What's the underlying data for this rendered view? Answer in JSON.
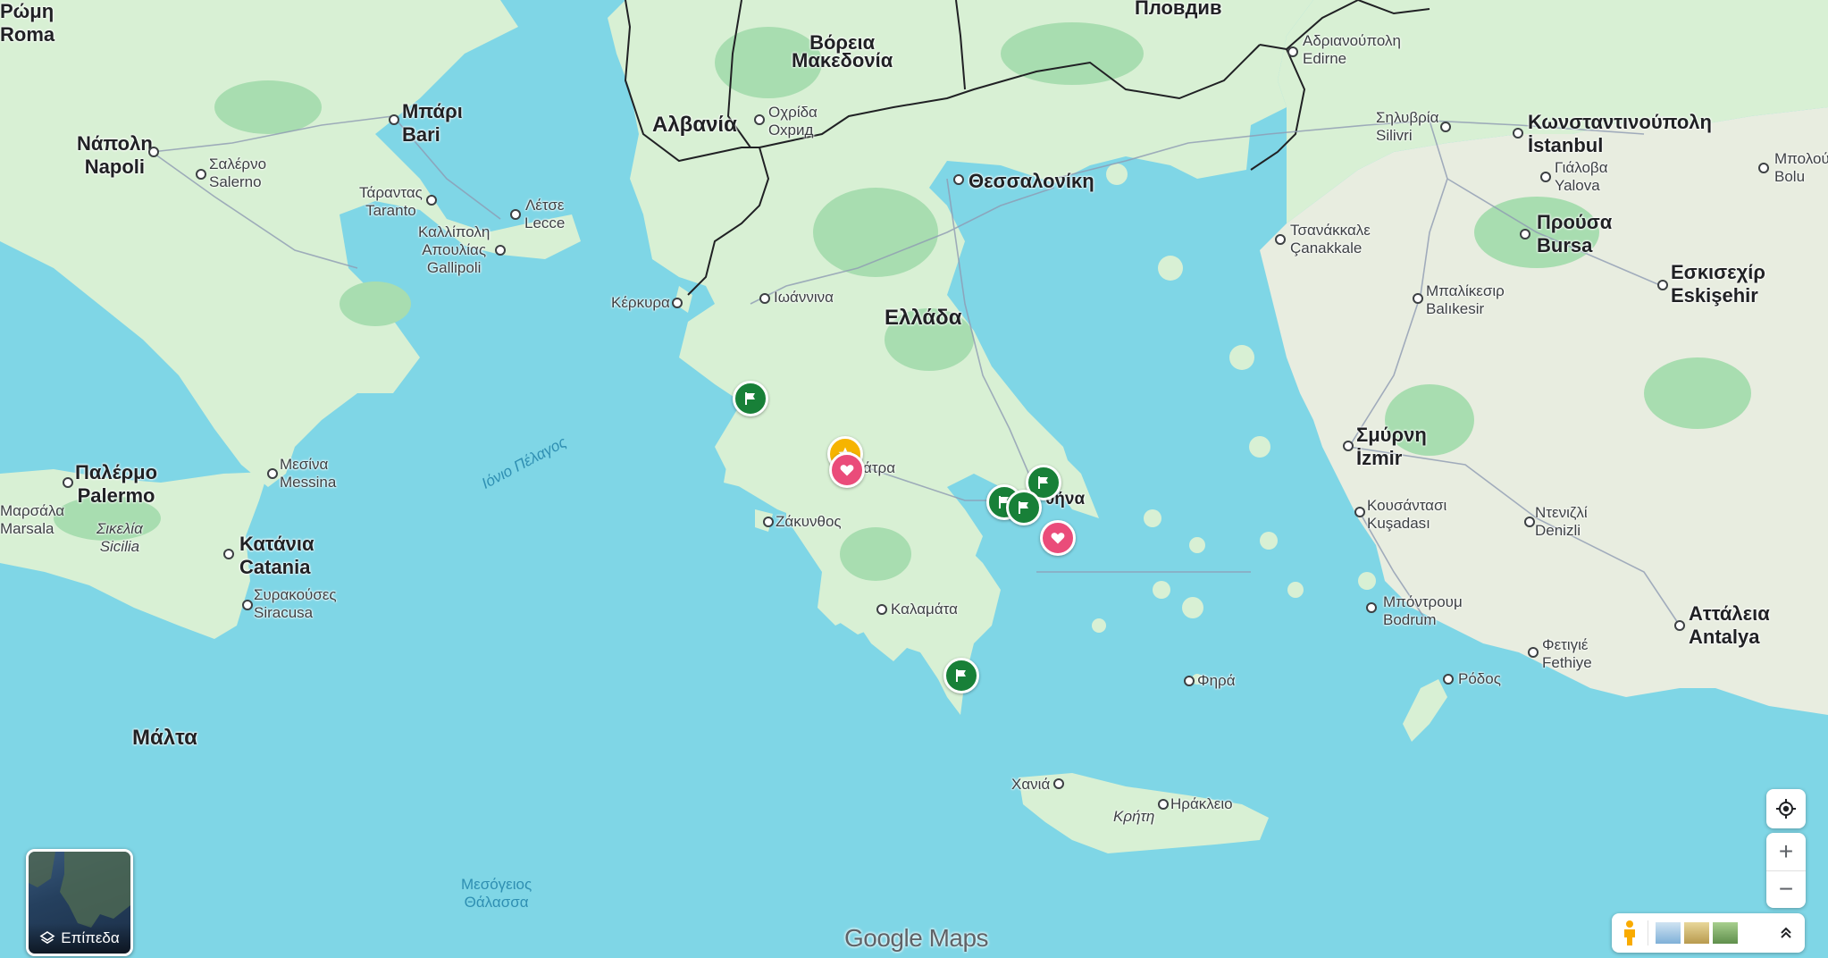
{
  "map": {
    "countries": [
      {
        "id": "albania",
        "name": "Αλβανία"
      },
      {
        "id": "north-macedonia",
        "name": "Βόρεια\nΜακεδονία"
      },
      {
        "id": "greece",
        "name": "Ελλάδα"
      },
      {
        "id": "malta",
        "name": "Μάλτα"
      }
    ],
    "cities": [
      {
        "id": "roma",
        "name": "Ρώμη\nRoma"
      },
      {
        "id": "napoli",
        "name": "Νάπολη\nNapoli"
      },
      {
        "id": "bari",
        "name": "Μπάρι\nBari"
      },
      {
        "id": "salerno",
        "name": "Σαλέρνο\nSalerno"
      },
      {
        "id": "taranto",
        "name": "Τάραντας\nTaranto"
      },
      {
        "id": "lecce",
        "name": "Λέτσε\nLecce"
      },
      {
        "id": "gallipoli",
        "name": "Καλλίπολη\nΑπουλίας\nGallipoli"
      },
      {
        "id": "palermo",
        "name": "Παλέρμο\nPalermo"
      },
      {
        "id": "messina",
        "name": "Μεσίνα\nMessina"
      },
      {
        "id": "marsala",
        "name": "Μαρσάλα\nMarsala"
      },
      {
        "id": "catania",
        "name": "Κατάνια\nCatania"
      },
      {
        "id": "siracusa",
        "name": "Συρακούσες\nSiracusa"
      },
      {
        "id": "ohrid",
        "name": "Οχρίδα\nОхрид"
      },
      {
        "id": "kerkyra",
        "name": "Κέρκυρα"
      },
      {
        "id": "ioannina",
        "name": "Ιωάννινα"
      },
      {
        "id": "thessaloniki",
        "name": "Θεσσαλονίκη"
      },
      {
        "id": "plovdiv",
        "name": "Пловдив"
      },
      {
        "id": "edirne",
        "name": "Αδριανούπολη\nEdirne"
      },
      {
        "id": "istanbul",
        "name": "Κωνσταντινούπολη\nİstanbul"
      },
      {
        "id": "silivri",
        "name": "Σηλυβρία\nSilivri"
      },
      {
        "id": "yalova",
        "name": "Γιάλοβα\nYalova"
      },
      {
        "id": "bolu",
        "name": "Μπολού\nBolu"
      },
      {
        "id": "canakkale",
        "name": "Τσανάκκαλε\nÇanakkale"
      },
      {
        "id": "bursa",
        "name": "Προύσα\nBursa"
      },
      {
        "id": "balikesir",
        "name": "Μπαλίκεσιρ\nBalıkesir"
      },
      {
        "id": "eskisehir",
        "name": "Εσκισεχίρ\nEskişehir"
      },
      {
        "id": "izmir",
        "name": "Σμύρνη\nİzmir"
      },
      {
        "id": "kusadasi",
        "name": "Κουσάντασι\nKuşadası"
      },
      {
        "id": "denizli",
        "name": "Ντενιζλί\nDenizli"
      },
      {
        "id": "bodrum",
        "name": "Μπόντρουμ\nBodrum"
      },
      {
        "id": "fethiye",
        "name": "Φετιγιέ\nFethiye"
      },
      {
        "id": "antalya",
        "name": "Αττάλεια\nAntalya"
      },
      {
        "id": "rodos",
        "name": "Ρόδος"
      },
      {
        "id": "patra",
        "name": "άτρα"
      },
      {
        "id": "athina",
        "name": "θήνα"
      },
      {
        "id": "zakynthos",
        "name": "Ζάκυνθος"
      },
      {
        "id": "kalamata",
        "name": "Καλαμάτα"
      },
      {
        "id": "fira",
        "name": "Φηρά"
      },
      {
        "id": "chania",
        "name": "Χανιά"
      },
      {
        "id": "irakleio",
        "name": "Ηράκλειο"
      }
    ],
    "islands": [
      {
        "id": "sicilia",
        "name": "Σικελία\nSicilia"
      },
      {
        "id": "kriti",
        "name": "Κρήτη"
      }
    ],
    "seas": [
      {
        "id": "ionian",
        "name": "Ιόνιο Πέλαγος"
      },
      {
        "id": "mediterranean",
        "name": "Μεσόγειος\nΘάλασσα"
      }
    ],
    "markers": [
      {
        "id": "flag-1",
        "type": "flag",
        "icon": "flag-icon"
      },
      {
        "id": "star-1",
        "type": "star",
        "icon": "star-icon"
      },
      {
        "id": "heart-1",
        "type": "heart",
        "icon": "heart-icon"
      },
      {
        "id": "flag-2",
        "type": "flag",
        "icon": "flag-icon"
      },
      {
        "id": "flag-3",
        "type": "flag",
        "icon": "flag-icon"
      },
      {
        "id": "flag-4",
        "type": "flag",
        "icon": "flag-icon"
      },
      {
        "id": "heart-2",
        "type": "heart",
        "icon": "heart-icon"
      },
      {
        "id": "flag-5",
        "type": "flag",
        "icon": "flag-icon"
      }
    ],
    "colors": {
      "water": "#7fd6e6",
      "land": "#d8f0d4",
      "forest": "#a8ddb0",
      "border": "#202124",
      "road": "#8f9bb3"
    }
  },
  "layers": {
    "label": "Επίπεδα"
  },
  "controls": {
    "my_location": "my-location-icon",
    "zoom_in": "+",
    "zoom_out": "−",
    "pegman": "pegman-icon",
    "expand": "expand-up-icon"
  },
  "logo": {
    "google": "Google",
    "maps": "Maps"
  }
}
